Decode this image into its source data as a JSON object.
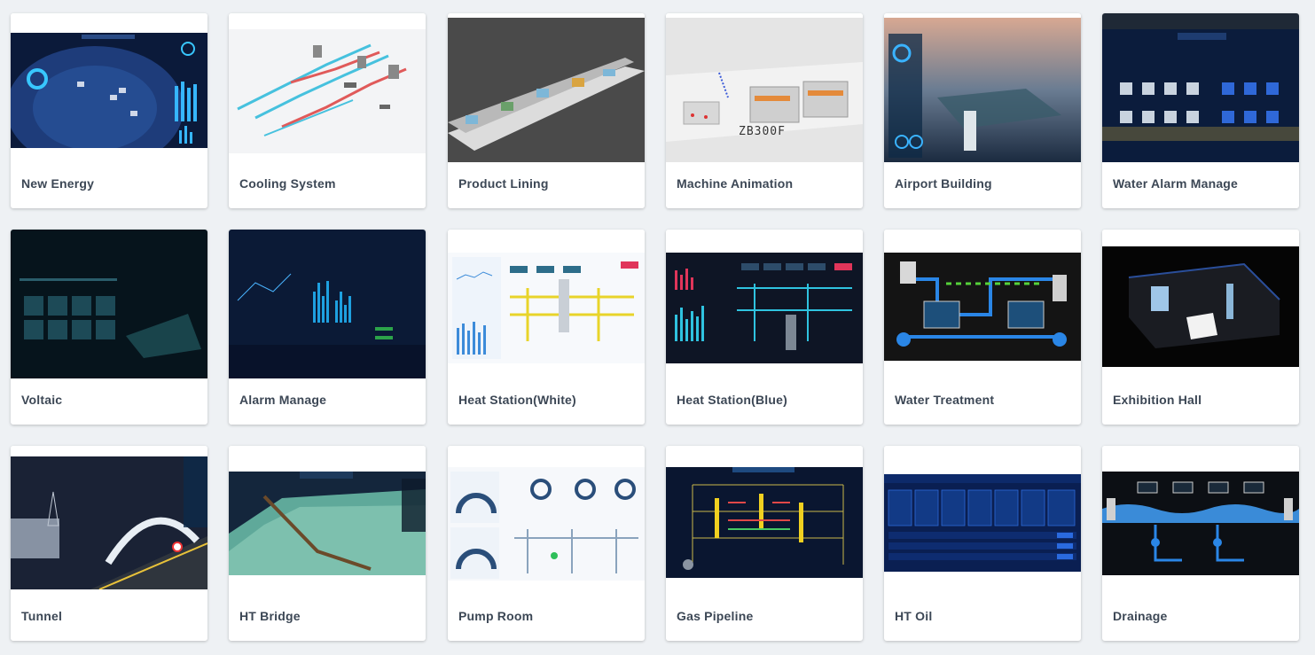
{
  "cards": [
    {
      "label": "New Energy",
      "icon": "new-energy-dashboard-thumbnail"
    },
    {
      "label": "Cooling System",
      "icon": "cooling-system-pipes-thumbnail"
    },
    {
      "label": "Product Lining",
      "icon": "product-line-3d-thumbnail"
    },
    {
      "label": "Machine Animation",
      "icon": "machine-animation-3d-thumbnail",
      "thumb_text": "ZB300F"
    },
    {
      "label": "Airport Building",
      "icon": "airport-building-3d-thumbnail"
    },
    {
      "label": "Water Alarm Manage",
      "icon": "water-alarm-dashboard-thumbnail"
    },
    {
      "label": "Voltaic",
      "icon": "voltaic-dashboard-thumbnail"
    },
    {
      "label": "Alarm Manage",
      "icon": "alarm-manage-dashboard-thumbnail"
    },
    {
      "label": "Heat Station(White)",
      "icon": "heat-station-white-thumbnail"
    },
    {
      "label": "Heat Station(Blue)",
      "icon": "heat-station-blue-thumbnail"
    },
    {
      "label": "Water Treatment",
      "icon": "water-treatment-thumbnail"
    },
    {
      "label": "Exhibition Hall",
      "icon": "exhibition-hall-3d-thumbnail"
    },
    {
      "label": "Tunnel",
      "icon": "tunnel-3d-thumbnail"
    },
    {
      "label": "HT Bridge",
      "icon": "ht-bridge-3d-thumbnail"
    },
    {
      "label": "Pump Room",
      "icon": "pump-room-thumbnail"
    },
    {
      "label": "Gas Pipeline",
      "icon": "gas-pipeline-thumbnail"
    },
    {
      "label": "HT Oil",
      "icon": "ht-oil-dashboard-thumbnail"
    },
    {
      "label": "Drainage",
      "icon": "drainage-thumbnail"
    }
  ]
}
